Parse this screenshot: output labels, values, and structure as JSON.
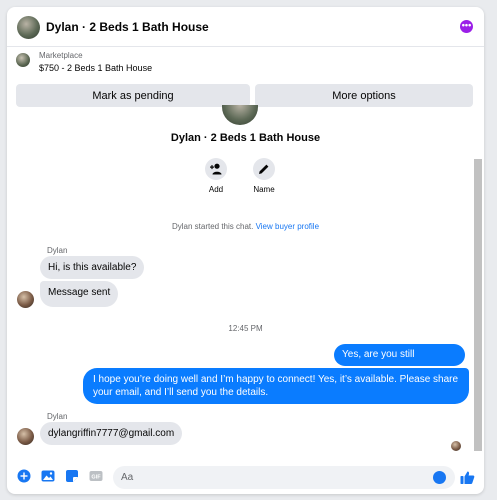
{
  "header": {
    "title": "Dylan · 2 Beds 1 Bath House",
    "menu_icon": "more-dots-icon"
  },
  "listing": {
    "kind": "Marketplace",
    "price_title": "$750 - 2 Beds 1 Bath House"
  },
  "actions": {
    "mark_pending": "Mark as pending",
    "more_options": "More options"
  },
  "conversation": {
    "title": "Dylan · 2 Beds 1 Bath House",
    "add_label": "Add",
    "name_label": "Name",
    "started_text": "Dylan started this chat.",
    "view_profile_link": "View buyer profile"
  },
  "messages": {
    "sender_1": "Dylan",
    "in_1": "Hi, is this available?",
    "in_2": "Message sent",
    "timestamp": "12:45 PM",
    "out_1": "Yes, are you still interested?",
    "out_2": "I hope you’re doing well and I’m happy to connect! Yes, it’s available. Please share your email, and I’ll send you the details.",
    "sender_2": "Dylan",
    "in_3": "dylangriffin7777@gmail.com"
  },
  "composer": {
    "placeholder": "Aa",
    "icons": [
      "plus-circle-icon",
      "photo-icon",
      "sticker-icon",
      "gif-icon",
      "emoji-icon",
      "thumbs-up-icon"
    ]
  },
  "colors": {
    "accent": "#0a7cff",
    "menu_purple": "#9b1fe8",
    "bubble_gray": "#e4e6eb"
  }
}
